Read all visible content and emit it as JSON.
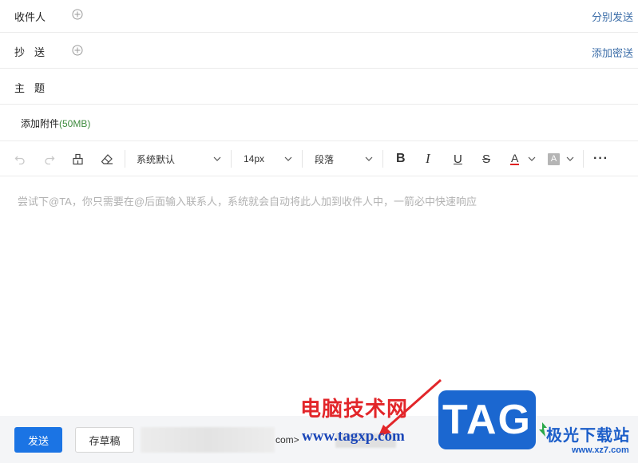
{
  "compose": {
    "to_label": "收件人",
    "cc_label": "抄送",
    "subject_label": "主题",
    "separate_send": "分别发送",
    "add_bcc": "添加密送",
    "attach_label": "添加附件",
    "attach_size": "(50MB)"
  },
  "toolbar": {
    "font_family": "系统默认",
    "font_size": "14px",
    "paragraph": "段落",
    "bold_glyph": "B",
    "italic_glyph": "I",
    "underline_glyph": "U",
    "strike_glyph": "S",
    "font_color_glyph": "A",
    "bg_color_glyph": "A",
    "more_glyph": "···",
    "font_color": "#e02020"
  },
  "editor": {
    "placeholder": "尝试下@TA，你只需要在@后面输入联系人，系统就会自动将此人加到收件人中，一箭必中快速响应"
  },
  "footer": {
    "send_label": "发送",
    "draft_label": "存草稿",
    "sender_tail": "com>"
  },
  "watermark": {
    "title": "电脑技术网",
    "url": "www.tagxp.com",
    "tag": "TAG",
    "site_name": "极光下载站",
    "site_url": "www.xz7.com"
  }
}
